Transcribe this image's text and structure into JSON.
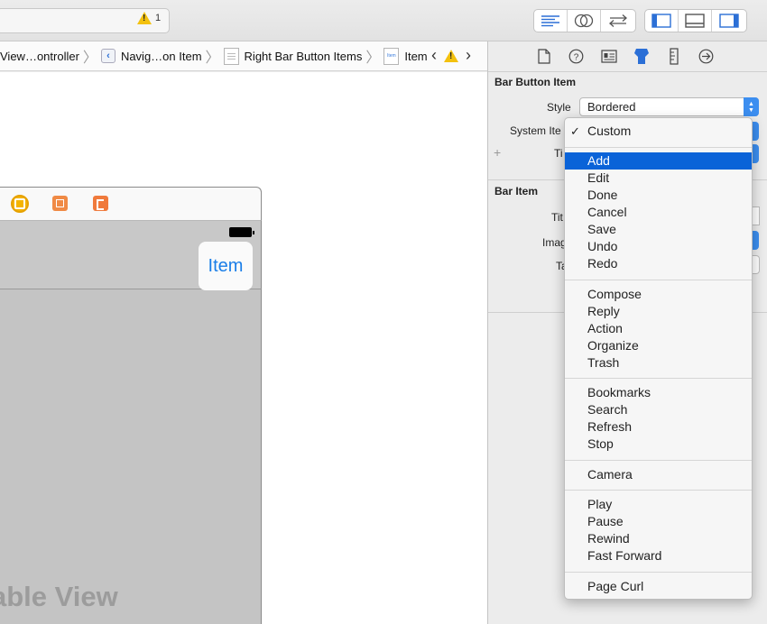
{
  "toolbar": {
    "warning_count": "1"
  },
  "jumpbar": {
    "crumbs": [
      "View…ontroller",
      "Navig…on Item",
      "Right Bar Button Items",
      "Item"
    ],
    "item_icon_text": "Item"
  },
  "canvas": {
    "item_button_label": "Item",
    "table_view_label": "able View"
  },
  "inspector": {
    "section_bar_button_item": "Bar Button Item",
    "style_label": "Style",
    "style_value": "Bordered",
    "system_item_label": "System Ite",
    "tint_label": "Ti",
    "add_symbol": "+",
    "section_bar_item": "Bar Item",
    "title_label": "Tit",
    "image_label": "Imag",
    "tag_label": "Ta"
  },
  "menu": {
    "checked_item": "Custom",
    "groups": [
      [
        "Add",
        "Edit",
        "Done",
        "Cancel",
        "Save",
        "Undo",
        "Redo"
      ],
      [
        "Compose",
        "Reply",
        "Action",
        "Organize",
        "Trash"
      ],
      [
        "Bookmarks",
        "Search",
        "Refresh",
        "Stop"
      ],
      [
        "Camera"
      ],
      [
        "Play",
        "Pause",
        "Rewind",
        "Fast Forward"
      ],
      [
        "Page Curl"
      ]
    ],
    "selected_item": "Add"
  },
  "colors": {
    "selection": "#0a63d8",
    "accent_blue": "#3c8ef0",
    "item_text": "#1a7ee8",
    "warning": "#f3c10e"
  }
}
